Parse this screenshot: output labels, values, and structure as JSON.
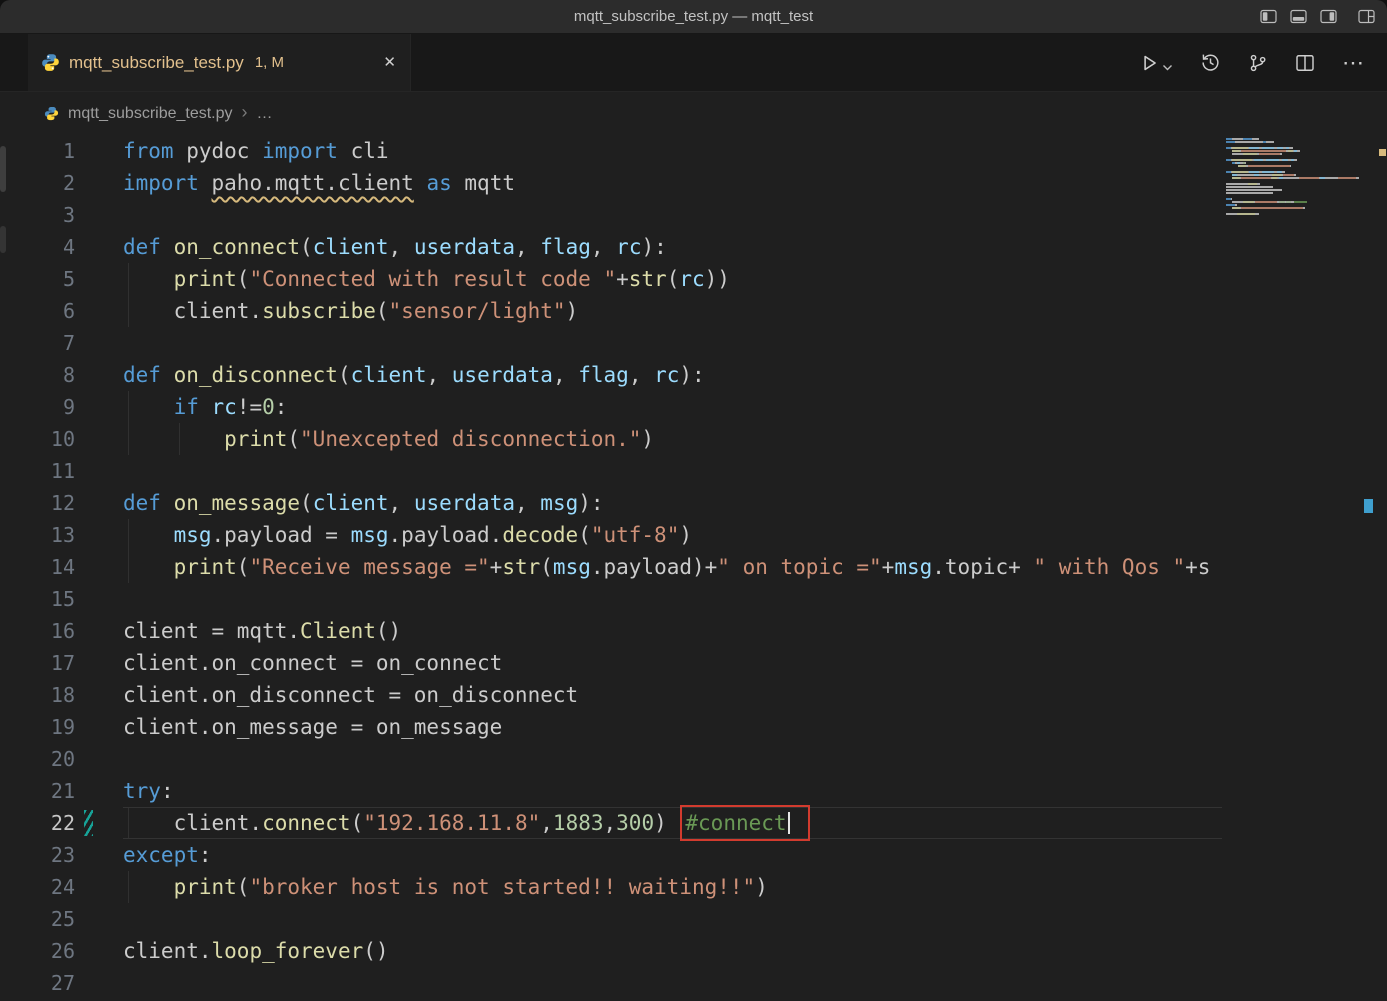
{
  "window": {
    "title": "mqtt_subscribe_test.py — mqtt_test"
  },
  "tab": {
    "label": "mqtt_subscribe_test.py",
    "badge": "1, M",
    "close_glyph": "✕"
  },
  "editor_actions": {
    "more_glyph": "⋯"
  },
  "breadcrumbs": {
    "file": "mqtt_subscribe_test.py",
    "separator": "›",
    "ellipsis": "…"
  },
  "editor": {
    "current_line": 22,
    "modified_line": 22,
    "token_colors": {
      "d": "#cccccc",
      "kw": "#569cd6",
      "fn": "#dcdcaa",
      "par": "#9cdcfe",
      "str": "#ce9178",
      "num": "#b5cea8",
      "com": "#6a9955",
      "warn": "#cccccc",
      "combox": "#6a9955"
    },
    "ui_colors": {
      "annotation_red": "#d23b2e",
      "warning_yellow": "#d7ba7d",
      "modified_gold": "#e2c08d",
      "git_green": "#17a398",
      "ruler_cursor_blue": "#3f9fce"
    },
    "lines": [
      [
        [
          "kw",
          "from"
        ],
        [
          "d",
          " pydoc "
        ],
        [
          "kw",
          "import"
        ],
        [
          "d",
          " cli"
        ]
      ],
      [
        [
          "kw",
          "import"
        ],
        [
          "d",
          " "
        ],
        [
          "warn",
          "paho.mqtt.client"
        ],
        [
          "d",
          " "
        ],
        [
          "kw",
          "as"
        ],
        [
          "d",
          " mqtt"
        ]
      ],
      [],
      [
        [
          "kw",
          "def"
        ],
        [
          "d",
          " "
        ],
        [
          "fn",
          "on_connect"
        ],
        [
          "d",
          "("
        ],
        [
          "par",
          "client"
        ],
        [
          "d",
          ", "
        ],
        [
          "par",
          "userdata"
        ],
        [
          "d",
          ", "
        ],
        [
          "par",
          "flag"
        ],
        [
          "d",
          ", "
        ],
        [
          "par",
          "rc"
        ],
        [
          "d",
          "):"
        ]
      ],
      [
        [
          "d",
          "    "
        ],
        [
          "fn",
          "print"
        ],
        [
          "d",
          "("
        ],
        [
          "str",
          "\"Connected with result code \""
        ],
        [
          "d",
          "+"
        ],
        [
          "fn",
          "str"
        ],
        [
          "d",
          "("
        ],
        [
          "par",
          "rc"
        ],
        [
          "d",
          "))"
        ]
      ],
      [
        [
          "d",
          "    client."
        ],
        [
          "fn",
          "subscribe"
        ],
        [
          "d",
          "("
        ],
        [
          "str",
          "\"sensor/light\""
        ],
        [
          "d",
          ")"
        ]
      ],
      [],
      [
        [
          "kw",
          "def"
        ],
        [
          "d",
          " "
        ],
        [
          "fn",
          "on_disconnect"
        ],
        [
          "d",
          "("
        ],
        [
          "par",
          "client"
        ],
        [
          "d",
          ", "
        ],
        [
          "par",
          "userdata"
        ],
        [
          "d",
          ", "
        ],
        [
          "par",
          "flag"
        ],
        [
          "d",
          ", "
        ],
        [
          "par",
          "rc"
        ],
        [
          "d",
          "):"
        ]
      ],
      [
        [
          "d",
          "    "
        ],
        [
          "kw",
          "if"
        ],
        [
          "d",
          " "
        ],
        [
          "par",
          "rc"
        ],
        [
          "d",
          "!="
        ],
        [
          "num",
          "0"
        ],
        [
          "d",
          ":"
        ]
      ],
      [
        [
          "d",
          "        "
        ],
        [
          "fn",
          "print"
        ],
        [
          "d",
          "("
        ],
        [
          "str",
          "\"Unexcepted disconnection.\""
        ],
        [
          "d",
          ")"
        ]
      ],
      [],
      [
        [
          "kw",
          "def"
        ],
        [
          "d",
          " "
        ],
        [
          "fn",
          "on_message"
        ],
        [
          "d",
          "("
        ],
        [
          "par",
          "client"
        ],
        [
          "d",
          ", "
        ],
        [
          "par",
          "userdata"
        ],
        [
          "d",
          ", "
        ],
        [
          "par",
          "msg"
        ],
        [
          "d",
          "):"
        ]
      ],
      [
        [
          "d",
          "    "
        ],
        [
          "par",
          "msg"
        ],
        [
          "d",
          ".payload = "
        ],
        [
          "par",
          "msg"
        ],
        [
          "d",
          ".payload."
        ],
        [
          "fn",
          "decode"
        ],
        [
          "d",
          "("
        ],
        [
          "str",
          "\"utf-8\""
        ],
        [
          "d",
          ")"
        ]
      ],
      [
        [
          "d",
          "    "
        ],
        [
          "fn",
          "print"
        ],
        [
          "d",
          "("
        ],
        [
          "str",
          "\"Receive message =\""
        ],
        [
          "d",
          "+"
        ],
        [
          "fn",
          "str"
        ],
        [
          "d",
          "("
        ],
        [
          "par",
          "msg"
        ],
        [
          "d",
          ".payload)+"
        ],
        [
          "str",
          "\" on topic =\""
        ],
        [
          "d",
          "+"
        ],
        [
          "par",
          "msg"
        ],
        [
          "d",
          ".topic+ "
        ],
        [
          "str",
          "\" with Qos \""
        ],
        [
          "d",
          "+s"
        ]
      ],
      [],
      [
        [
          "d",
          "client = mqtt."
        ],
        [
          "fn",
          "Client"
        ],
        [
          "d",
          "()"
        ]
      ],
      [
        [
          "d",
          "client.on_connect = on_connect"
        ]
      ],
      [
        [
          "d",
          "client.on_disconnect = on_disconnect"
        ]
      ],
      [
        [
          "d",
          "client.on_message = on_message"
        ]
      ],
      [],
      [
        [
          "kw",
          "try"
        ],
        [
          "d",
          ":"
        ]
      ],
      [
        [
          "d",
          "    client."
        ],
        [
          "fn",
          "connect"
        ],
        [
          "d",
          "("
        ],
        [
          "str",
          "\"192.168.11.8\""
        ],
        [
          "d",
          ","
        ],
        [
          "num",
          "1883"
        ],
        [
          "d",
          ","
        ],
        [
          "num",
          "300"
        ],
        [
          "d",
          ") "
        ],
        [
          "combox",
          "#connect"
        ]
      ],
      [
        [
          "kw",
          "except"
        ],
        [
          "d",
          ":"
        ]
      ],
      [
        [
          "d",
          "    "
        ],
        [
          "fn",
          "print"
        ],
        [
          "d",
          "("
        ],
        [
          "str",
          "\"broker host is not started!! waiting!!\""
        ],
        [
          "d",
          ")"
        ]
      ],
      [],
      [
        [
          "d",
          "client."
        ],
        [
          "fn",
          "loop_forever"
        ],
        [
          "d",
          "()"
        ]
      ],
      []
    ]
  }
}
